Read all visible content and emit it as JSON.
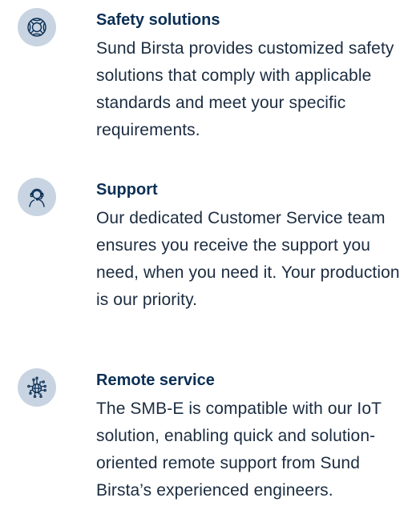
{
  "features": [
    {
      "icon": "lifebuoy-icon",
      "title": "Safety solutions",
      "text": "Sund Birsta provides customized safety solutions that comply with applicable standards and meet your specific requirements."
    },
    {
      "icon": "headset-support-icon",
      "title": "Support",
      "text": "Our dedicated Customer Service team ensures you receive the support you need, when you need it. Your production is our priority."
    },
    {
      "icon": "globe-network-icon",
      "title": "Remote service",
      "text": "The SMB-E is compatible with our IoT solution, enabling quick and solution-oriented remote support from Sund Birsta’s experienced engineers."
    }
  ],
  "colors": {
    "icon_background": "#c8d4e1",
    "icon_stroke": "#0b2f55",
    "title": "#0b2f55",
    "text": "#1b2c40"
  }
}
